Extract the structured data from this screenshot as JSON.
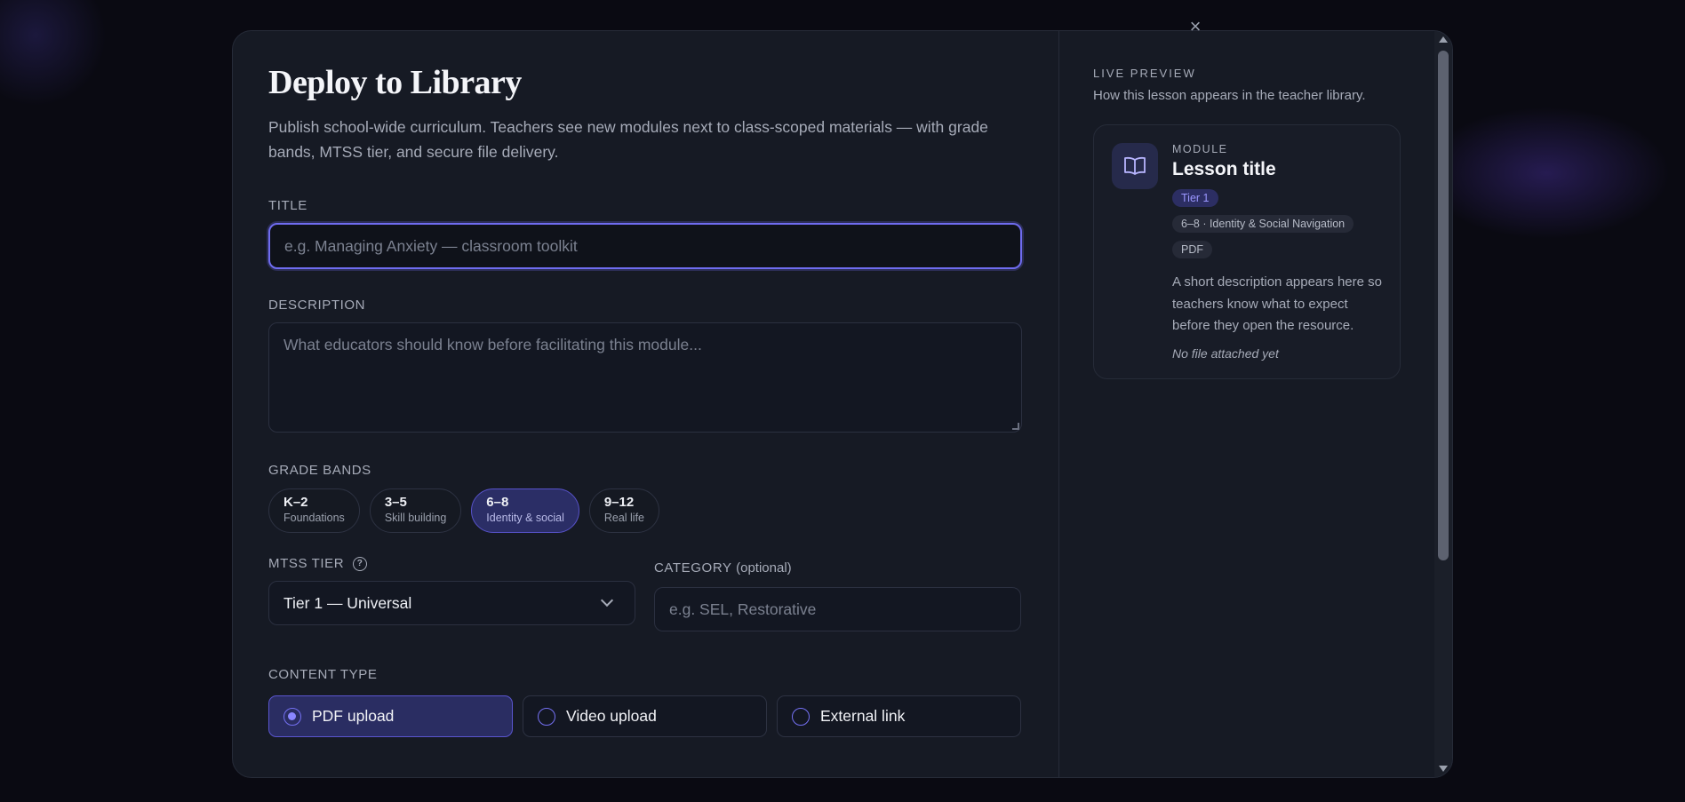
{
  "modal": {
    "title": "Deploy to Library",
    "subtitle": "Publish school-wide curriculum. Teachers see new modules next to class-scoped materials — with grade bands, MTSS tier, and secure file delivery.",
    "close_icon": "×"
  },
  "form": {
    "title_label": "TITLE",
    "title_placeholder": "e.g. Managing Anxiety — classroom toolkit",
    "description_label": "DESCRIPTION",
    "description_placeholder": "What educators should know before facilitating this module...",
    "grade_bands_label": "GRADE BANDS",
    "grade_bands": [
      {
        "title": "K–2",
        "subtitle": "Foundations",
        "selected": false
      },
      {
        "title": "3–5",
        "subtitle": "Skill building",
        "selected": false
      },
      {
        "title": "6–8",
        "subtitle": "Identity & social",
        "selected": true
      },
      {
        "title": "9–12",
        "subtitle": "Real life",
        "selected": false
      }
    ],
    "mtss_label": "MTSS TIER",
    "mtss_help_icon": "?",
    "mtss_value": "Tier 1 — Universal",
    "category_label": "CATEGORY",
    "category_optional": "(optional)",
    "category_placeholder": "e.g. SEL, Restorative",
    "content_type_label": "CONTENT TYPE",
    "content_types": [
      {
        "label": "PDF upload",
        "selected": true
      },
      {
        "label": "Video upload",
        "selected": false
      },
      {
        "label": "External link",
        "selected": false
      }
    ]
  },
  "preview": {
    "label": "LIVE PREVIEW",
    "subtitle": "How this lesson appears in the teacher library.",
    "card": {
      "icon": "book-open-icon",
      "kicker": "MODULE",
      "title": "Lesson title",
      "badge_tier": "Tier 1",
      "badge_grade": "6–8 · Identity & Social Navigation",
      "badge_type": "PDF",
      "description": "A short description appears here so teachers know what to expect before they open the resource.",
      "file_status": "No file attached yet"
    }
  },
  "colors": {
    "accent": "#6f6cf0",
    "background": "#161a24",
    "selected_chip": "#2b2e66"
  }
}
